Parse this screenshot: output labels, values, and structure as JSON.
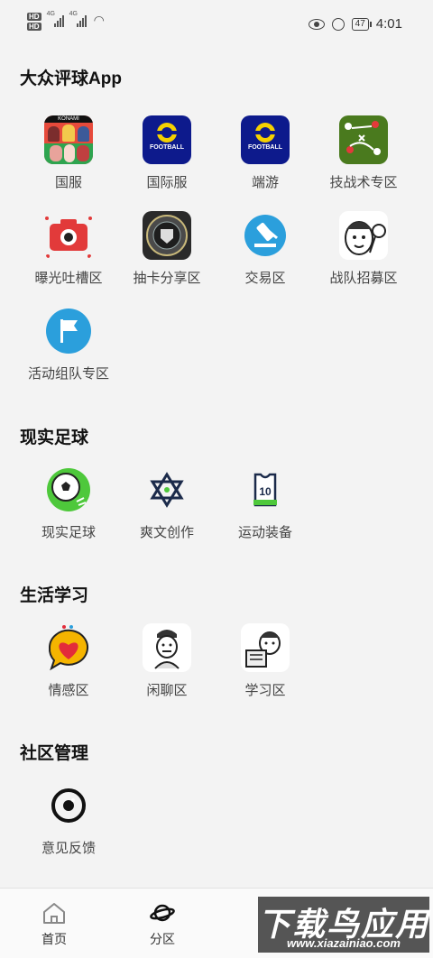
{
  "status_bar": {
    "hd1": "HD",
    "hd2": "HD",
    "net1": "4G",
    "net2": "4G",
    "battery": "47",
    "time": "4:01"
  },
  "sections": [
    {
      "title": "大众评球App",
      "items": [
        {
          "label": "国服",
          "icon": "konami-game-icon"
        },
        {
          "label": "国际服",
          "icon": "efootball-icon"
        },
        {
          "label": "端游",
          "icon": "efootball-icon"
        },
        {
          "label": "技战术专区",
          "icon": "tactics-board-icon"
        },
        {
          "label": "曝光吐槽区",
          "icon": "camera-icon"
        },
        {
          "label": "抽卡分享区",
          "icon": "card-icon"
        },
        {
          "label": "交易区",
          "icon": "gavel-icon"
        },
        {
          "label": "战队招募区",
          "icon": "meme-face-icon"
        },
        {
          "label": "活动组队专区",
          "icon": "flag-icon"
        }
      ]
    },
    {
      "title": "现实足球",
      "items": [
        {
          "label": "现实足球",
          "icon": "soccer-ball-icon"
        },
        {
          "label": "爽文创作",
          "icon": "star-of-david-icon"
        },
        {
          "label": "运动装备",
          "icon": "jersey-icon"
        }
      ]
    },
    {
      "title": "生活学习",
      "items": [
        {
          "label": "情感区",
          "icon": "heart-bubble-icon"
        },
        {
          "label": "闲聊区",
          "icon": "chat-meme-icon"
        },
        {
          "label": "学习区",
          "icon": "study-meme-icon"
        }
      ]
    },
    {
      "title": "社区管理",
      "items": [
        {
          "label": "意见反馈",
          "icon": "feedback-icon"
        }
      ]
    }
  ],
  "icon_texts": {
    "konami": "KONAMI",
    "football": "FOOTBALL",
    "jersey_number": "10"
  },
  "bottom_nav": [
    {
      "label": "首页",
      "icon": "home-icon"
    },
    {
      "label": "分区",
      "icon": "planet-icon"
    }
  ],
  "watermark": {
    "title": "下载鸟应用",
    "url": "www.xiazainiao.com"
  },
  "colors": {
    "background": "#f3f3f3",
    "efootball_blue": "#0d1a8c",
    "camera_red": "#e23a3a",
    "accent_blue": "#2b9fdc",
    "soccer_green": "#4ec83b"
  }
}
